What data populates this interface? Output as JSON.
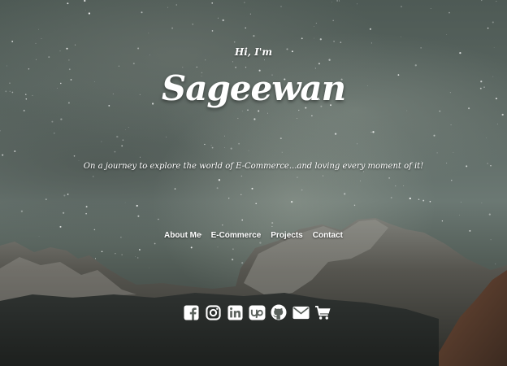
{
  "hero": {
    "greeting": "Hi, I'm",
    "name": "Sageewan",
    "tagline": "On a journey to explore the world of E-Commerce...and loving every moment of it!"
  },
  "nav": {
    "items": [
      {
        "label": "About Me"
      },
      {
        "label": "E-Commerce"
      },
      {
        "label": "Projects"
      },
      {
        "label": "Contact"
      }
    ]
  },
  "social": {
    "icons": [
      "facebook-icon",
      "instagram-icon",
      "linkedin-icon",
      "upwork-icon",
      "github-icon",
      "email-icon",
      "shopping-cart-icon"
    ]
  },
  "colors": {
    "text": "#ffffff",
    "sky": "#5b6762",
    "mountain_dark": "#2b2f2c"
  }
}
